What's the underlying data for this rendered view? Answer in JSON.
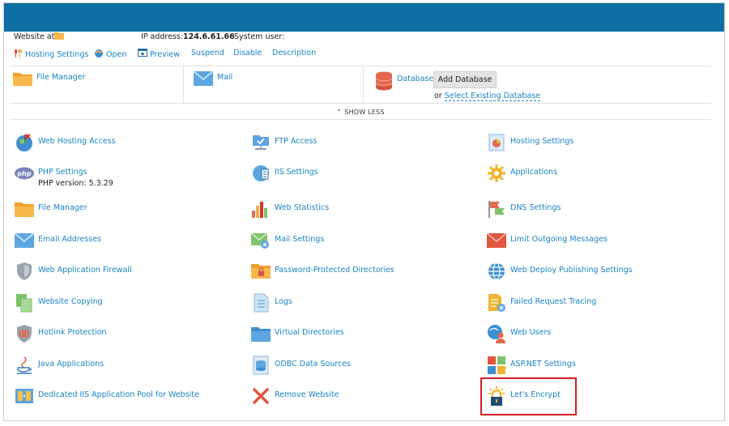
{
  "info": {
    "website_at": "Website at",
    "ip_label": "IP address:",
    "ip_value": "124.6.61.66",
    "system_user": "System user:"
  },
  "actions": [
    {
      "label": "Hosting Settings",
      "icon": "tools-icon"
    },
    {
      "label": "Open",
      "icon": "globe-icon"
    },
    {
      "label": "Preview",
      "icon": "preview-icon"
    },
    {
      "label": "Suspend"
    },
    {
      "label": "Disable"
    },
    {
      "label": "Description"
    }
  ],
  "quick": {
    "file_manager": "File Manager",
    "mail": "Mail",
    "databases": "Databases",
    "add_database": "Add Database",
    "or": "or",
    "select_existing": "Select Existing Database"
  },
  "show_less": "SHOW LESS",
  "grid": {
    "col1": [
      {
        "label": "Web Hosting Access",
        "icon": "web-hosting-access-icon"
      },
      {
        "label": "PHP Settings",
        "sub": "PHP version: 5.3.29",
        "icon": "php-icon"
      },
      {
        "label": "File Manager",
        "icon": "folder-icon"
      },
      {
        "label": "Email Addresses",
        "icon": "envelope-icon"
      },
      {
        "label": "Web Application Firewall",
        "icon": "shield-icon"
      },
      {
        "label": "Website Copying",
        "icon": "copy-icon"
      },
      {
        "label": "Hotlink Protection",
        "icon": "hotlink-shield-icon"
      },
      {
        "label": "Java Applications",
        "icon": "java-icon"
      },
      {
        "label": "Dedicated IIS Application Pool for Website",
        "icon": "app-pool-icon"
      }
    ],
    "col2": [
      {
        "label": "FTP Access",
        "icon": "ftp-icon"
      },
      {
        "label": "IIS Settings",
        "icon": "iis-icon"
      },
      {
        "label": "Web Statistics",
        "icon": "bar-chart-icon"
      },
      {
        "label": "Mail Settings",
        "icon": "mail-settings-icon"
      },
      {
        "label": "Password-Protected Directories",
        "icon": "locked-folder-icon"
      },
      {
        "label": "Logs",
        "icon": "logs-icon"
      },
      {
        "label": "Virtual Directories",
        "icon": "folder-blue-icon"
      },
      {
        "label": "ODBC Data Sources",
        "icon": "database-icon"
      },
      {
        "label": "Remove Website",
        "icon": "remove-x-icon"
      }
    ],
    "col3": [
      {
        "label": "Hosting Settings",
        "icon": "hosting-settings-icon"
      },
      {
        "label": "Applications",
        "icon": "gear-icon"
      },
      {
        "label": "DNS Settings",
        "icon": "dns-icon"
      },
      {
        "label": "Limit Outgoing Messages",
        "icon": "envelope-red-icon"
      },
      {
        "label": "Web Deploy Publishing Settings",
        "icon": "web-deploy-globe-icon"
      },
      {
        "label": "Failed Request Tracing",
        "icon": "failed-request-icon"
      },
      {
        "label": "Web Users",
        "icon": "web-users-icon"
      },
      {
        "label": "ASP.NET Settings",
        "icon": "windows-icon"
      },
      {
        "label": "Let's Encrypt",
        "icon": "lock-icon"
      }
    ]
  }
}
